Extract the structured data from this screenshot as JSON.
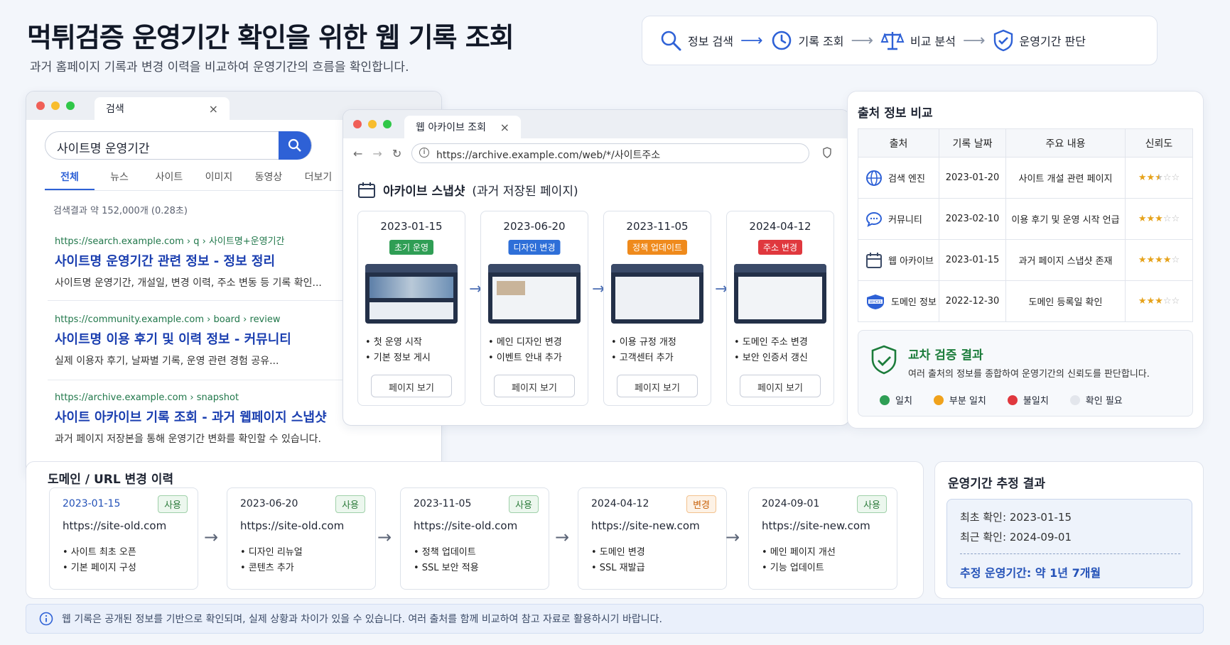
{
  "header": {
    "title": "먹튀검증 운영기간 확인을 위한 웹 기록 조회",
    "subtitle": "과거 홈페이지 기록과 변경 이력을 비교하여 운영기간의 흐름을 확인합니다."
  },
  "steps": [
    {
      "label": "정보 검색",
      "icon": "search-icon"
    },
    {
      "label": "기록 조회",
      "icon": "clock-icon"
    },
    {
      "label": "비교 분석",
      "icon": "scale-icon"
    },
    {
      "label": "운영기간 판단",
      "icon": "shield-check-icon"
    }
  ],
  "search_window": {
    "tab_title": "검색",
    "query": "사이트명 운영기간",
    "tabs": [
      "전체",
      "뉴스",
      "사이트",
      "이미지",
      "동영상",
      "더보기"
    ],
    "active_tab": "전체",
    "result_count": "검색결과 약 152,000개 (0.28초)",
    "results": [
      {
        "url": "https://search.example.com › q › 사이트명+운영기간",
        "title": "사이트명 운영기간 관련 정보 - 정보 정리",
        "desc": "사이트명 운영기간, 개설일, 변경 이력, 주소 변동 등 기록 확인..."
      },
      {
        "url": "https://community.example.com › board › review",
        "title": "사이트명 이용 후기 및 이력 정보 - 커뮤니티",
        "desc": "실제 이용자 후기, 날짜별 기록, 운영 관련 경험 공유..."
      },
      {
        "url": "https://archive.example.com › snapshot",
        "title": "사이트 아카이브 기록 조회 - 과거 웹페이지 스냅샷",
        "desc": "과거 페이지 저장본을 통해 운영기간 변화를 확인할 수 있습니다."
      }
    ]
  },
  "archive_window": {
    "tab_title": "웹 아카이브 조회",
    "url": "https://archive.example.com/web/*/사이트주소",
    "heading": "아카이브 스냅샷",
    "heading_note": "(과거 저장된 페이지)",
    "snapshots": [
      {
        "date": "2023-01-15",
        "badge": "초기 운영",
        "badge_color": "#2f9e55",
        "bullets": [
          "• 첫 운영 시작",
          "• 기본 정보 게시"
        ],
        "button": "페이지 보기"
      },
      {
        "date": "2023-06-20",
        "badge": "디자인 변경",
        "badge_color": "#2e6fd8",
        "bullets": [
          "• 메인 디자인 변경",
          "• 이벤트 안내 추가"
        ],
        "button": "페이지 보기"
      },
      {
        "date": "2023-11-05",
        "badge": "정책 업데이트",
        "badge_color": "#ef8a1c",
        "bullets": [
          "• 이용 규정 개정",
          "• 고객센터 추가"
        ],
        "button": "페이지 보기"
      },
      {
        "date": "2024-04-12",
        "badge": "주소 변경",
        "badge_color": "#e0383e",
        "bullets": [
          "• 도메인 주소 변경",
          "• 보안 인증서 갱신"
        ],
        "button": "페이지 보기"
      }
    ]
  },
  "compare": {
    "title": "출처 정보 비교",
    "headers": [
      "출처",
      "기록 날짜",
      "주요 내용",
      "신뢰도"
    ],
    "rows": [
      {
        "source": "검색 엔진",
        "icon": "globe-icon",
        "date": "2023-01-20",
        "content": "사이트 개설 관련 페이지",
        "rating": 2.5
      },
      {
        "source": "커뮤니티",
        "icon": "chat-icon",
        "date": "2023-02-10",
        "content": "이용 후기 및 운영 시작 언급",
        "rating": 3
      },
      {
        "source": "웹 아카이브",
        "icon": "calendar-icon",
        "date": "2023-01-15",
        "content": "과거 페이지 스냅샷 존재",
        "rating": 4
      },
      {
        "source": "도메인 정보",
        "icon": "whois-icon",
        "date": "2022-12-30",
        "content": "도메인 등록일 확인",
        "rating": 3
      }
    ],
    "verify_title": "교차 검증 결과",
    "verify_desc": "여러 출처의 정보를 종합하여 운영기간의 신뢰도를 판단합니다.",
    "legend": [
      {
        "label": "일치",
        "color": "#2f9e55"
      },
      {
        "label": "부분 일치",
        "color": "#f0a21c"
      },
      {
        "label": "불일치",
        "color": "#e0383e"
      },
      {
        "label": "확인 필요",
        "color": "#e3e6ec"
      }
    ]
  },
  "domain_history": {
    "title": "도메인 / URL 변경 이력",
    "entries": [
      {
        "date": "2023-01-15",
        "status": "사용",
        "url": "https://site-old.com",
        "bullets": [
          "• 사이트 최초 오픈",
          "• 기본 페이지 구성"
        ]
      },
      {
        "date": "2023-06-20",
        "status": "사용",
        "url": "https://site-old.com",
        "bullets": [
          "• 디자인 리뉴얼",
          "• 콘텐츠 추가"
        ]
      },
      {
        "date": "2023-11-05",
        "status": "사용",
        "url": "https://site-old.com",
        "bullets": [
          "• 정책 업데이트",
          "• SSL 보안 적용"
        ]
      },
      {
        "date": "2024-04-12",
        "status": "변경",
        "url": "https://site-new.com",
        "bullets": [
          "• 도메인 변경",
          "• SSL 재발급"
        ]
      },
      {
        "date": "2024-09-01",
        "status": "사용",
        "url": "https://site-new.com",
        "bullets": [
          "• 메인 페이지 개선",
          "• 기능 업데이트"
        ]
      }
    ]
  },
  "estimate": {
    "title": "운영기간 추정 결과",
    "first_label": "최초 확인:",
    "first_value": "2023-01-15",
    "last_label": "최근 확인:",
    "last_value": "2024-09-01",
    "result": "추정 운영기간: 약 1년 7개월"
  },
  "notice": "웹 기록은 공개된 정보를 기반으로 확인되며, 실제 상황과 차이가 있을 수 있습니다. 여러 출처를 함께 비교하여 참고 자료로 활용하시기 바랍니다."
}
